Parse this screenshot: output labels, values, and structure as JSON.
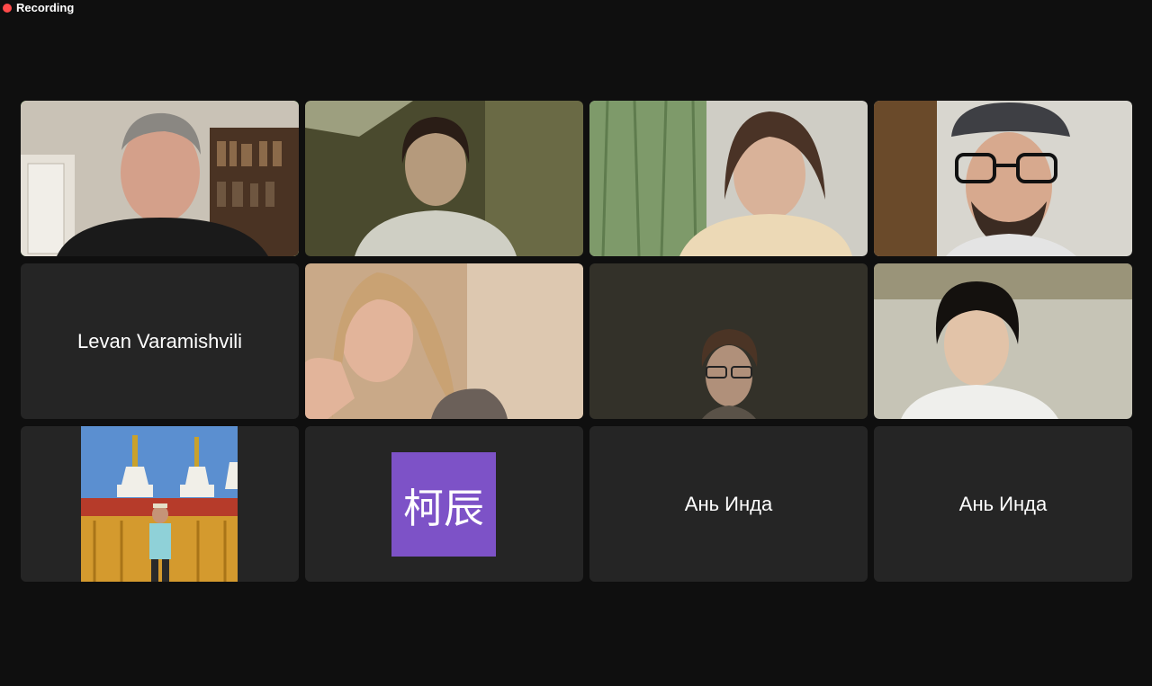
{
  "recording": {
    "label": "Recording",
    "color": "#ff4a4a"
  },
  "active_speaker_color": "#7ddc6a",
  "tiles": [
    {
      "type": "video",
      "description": "man with gray hair in room with bookshelf",
      "speaking": true
    },
    {
      "type": "video",
      "description": "woman with dark hair in dim room"
    },
    {
      "type": "video",
      "description": "woman with brown hair by green curtain"
    },
    {
      "type": "video",
      "description": "man with glasses and cap"
    },
    {
      "type": "name",
      "name": "Levan Varamishvili"
    },
    {
      "type": "video",
      "description": "blonde woman resting chin on hand"
    },
    {
      "type": "video",
      "description": "person with glasses in dark room"
    },
    {
      "type": "video",
      "description": "young man with dark hair"
    },
    {
      "type": "photo",
      "description": "profile photo in front of stupas"
    },
    {
      "type": "avatar",
      "initials": "柯辰",
      "color": "#7d52c7"
    },
    {
      "type": "name",
      "name": "Ань Инда"
    },
    {
      "type": "name",
      "name": "Ань Инда"
    }
  ]
}
